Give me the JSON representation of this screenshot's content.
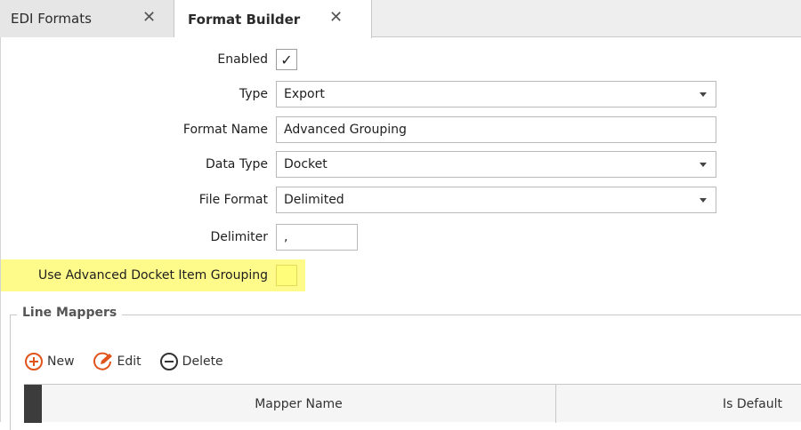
{
  "tabs": [
    {
      "label": "EDI Formats",
      "close": "✕",
      "active": false
    },
    {
      "label": "Format Builder",
      "close": "✕",
      "active": true
    }
  ],
  "form": {
    "enabled_label": "Enabled",
    "enabled_checked": true,
    "enabled_mark": "✓",
    "type_label": "Type",
    "type_value": "Export",
    "format_name_label": "Format Name",
    "format_name_value": "Advanced Grouping",
    "data_type_label": "Data Type",
    "data_type_value": "Docket",
    "file_format_label": "File Format",
    "file_format_value": "Delimited",
    "delimiter_label": "Delimiter",
    "delimiter_value": ",",
    "advanced_grouping_label": "Use Advanced Docket Item Grouping",
    "advanced_grouping_checked": false
  },
  "line_mappers": {
    "title": "Line Mappers",
    "toolbar": [
      {
        "label": "New",
        "icon": "plus-circle-icon",
        "color": "#e0541c"
      },
      {
        "label": "Edit",
        "icon": "edit-pencil-icon",
        "color": "#e0541c"
      },
      {
        "label": "Delete",
        "icon": "minus-circle-icon",
        "color": "#333333"
      }
    ],
    "columns": [
      "Mapper Name",
      "Is Default"
    ]
  },
  "colors": {
    "highlight": "#fffb8a",
    "accent_orange": "#e0541c"
  }
}
